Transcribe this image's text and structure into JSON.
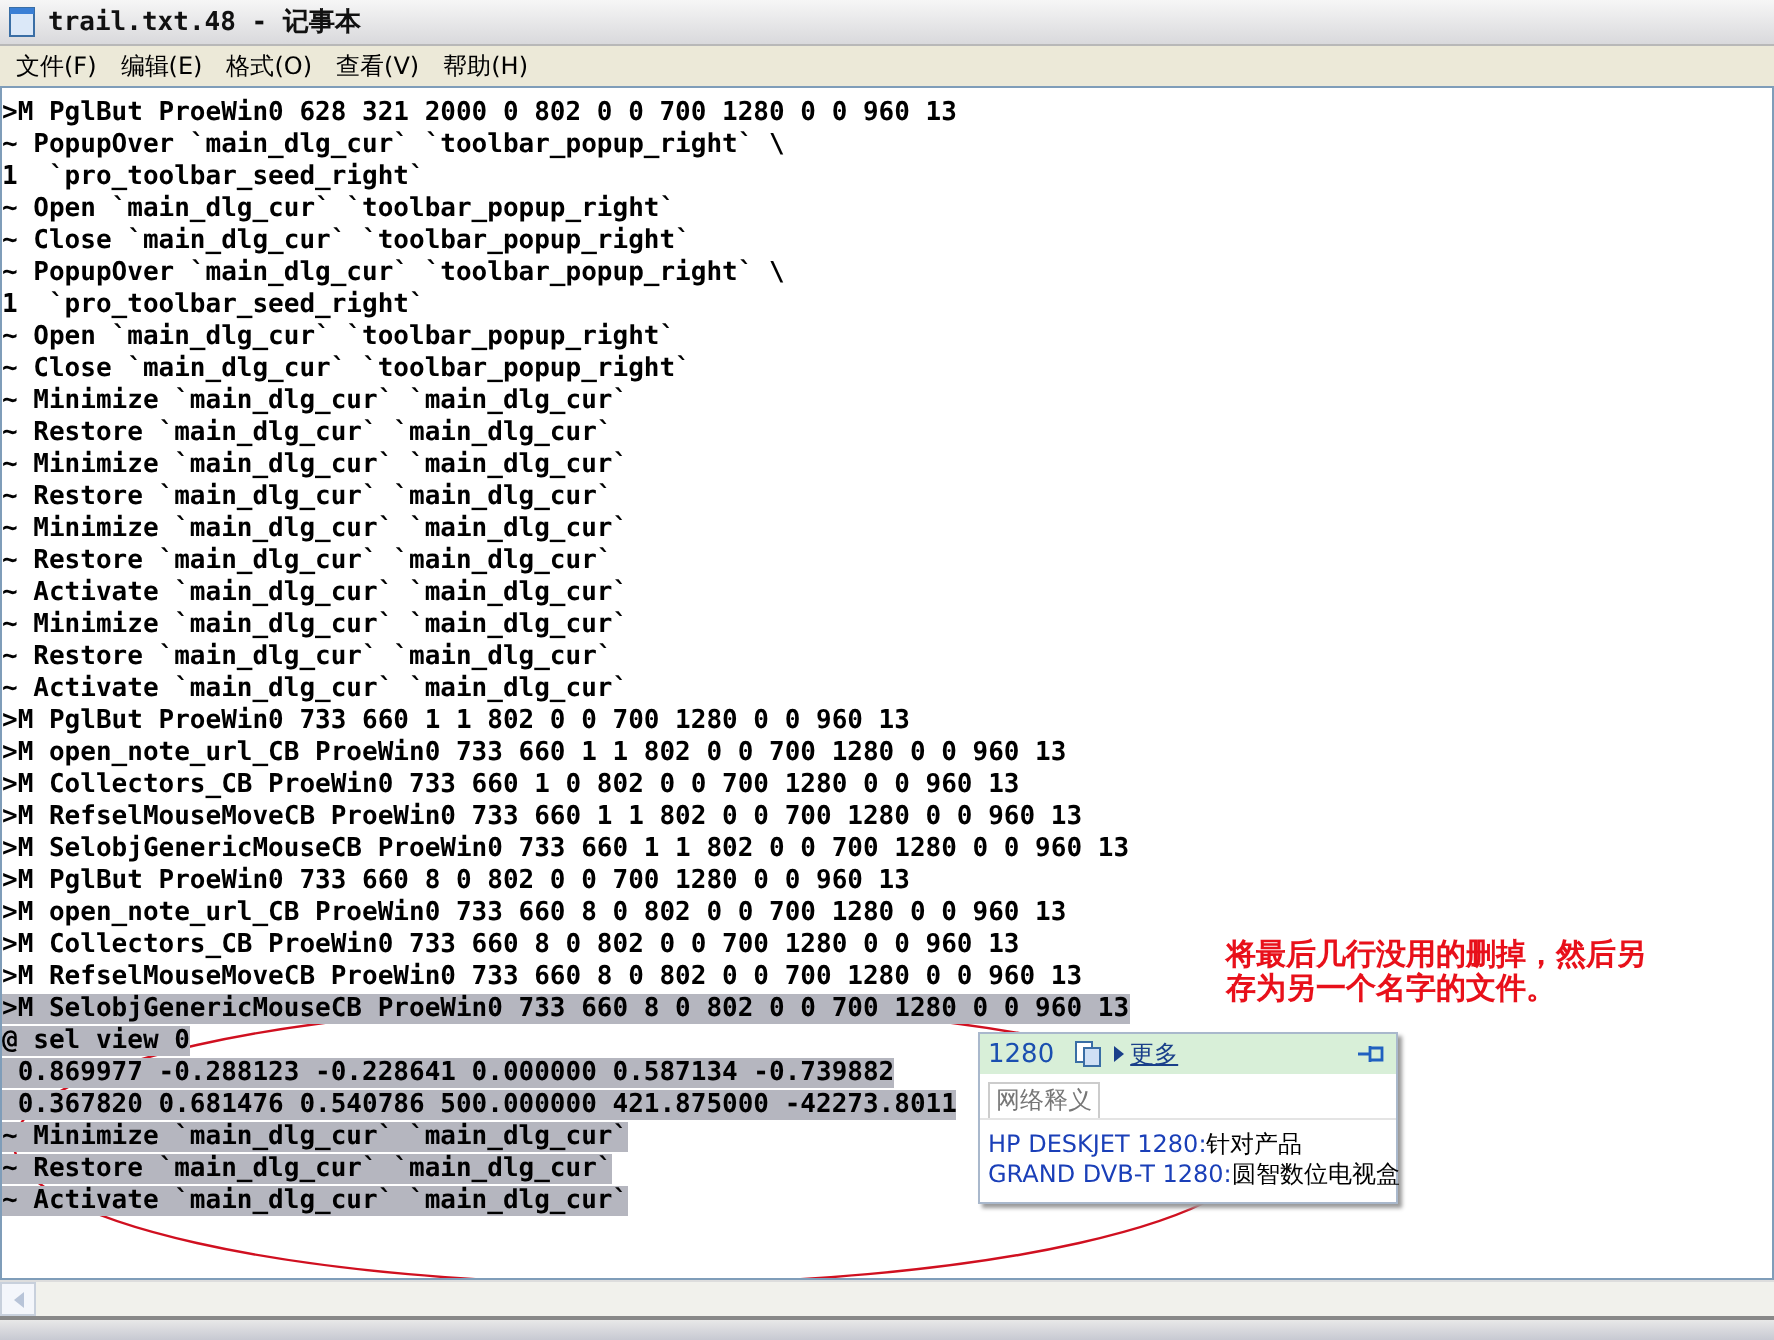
{
  "window": {
    "title": "trail.txt.48 - 记事本"
  },
  "menu": [
    "文件(F)",
    "编辑(E)",
    "格式(O)",
    "查看(V)",
    "帮助(H)"
  ],
  "lines": [
    {
      "text": ">M PglBut ProeWin0 628 321 2000 0 802 0 0 700 1280 0 0 960 13",
      "selected": false
    },
    {
      "text": "~ PopupOver `main_dlg_cur` `toolbar_popup_right` \\",
      "selected": false
    },
    {
      "text": "1  `pro_toolbar_seed_right`",
      "selected": false
    },
    {
      "text": "~ Open `main_dlg_cur` `toolbar_popup_right`",
      "selected": false
    },
    {
      "text": "~ Close `main_dlg_cur` `toolbar_popup_right`",
      "selected": false
    },
    {
      "text": "~ PopupOver `main_dlg_cur` `toolbar_popup_right` \\",
      "selected": false
    },
    {
      "text": "1  `pro_toolbar_seed_right`",
      "selected": false
    },
    {
      "text": "~ Open `main_dlg_cur` `toolbar_popup_right`",
      "selected": false
    },
    {
      "text": "~ Close `main_dlg_cur` `toolbar_popup_right`",
      "selected": false
    },
    {
      "text": "~ Minimize `main_dlg_cur` `main_dlg_cur`",
      "selected": false
    },
    {
      "text": "~ Restore `main_dlg_cur` `main_dlg_cur`",
      "selected": false
    },
    {
      "text": "~ Minimize `main_dlg_cur` `main_dlg_cur`",
      "selected": false
    },
    {
      "text": "~ Restore `main_dlg_cur` `main_dlg_cur`",
      "selected": false
    },
    {
      "text": "~ Minimize `main_dlg_cur` `main_dlg_cur`",
      "selected": false
    },
    {
      "text": "~ Restore `main_dlg_cur` `main_dlg_cur`",
      "selected": false
    },
    {
      "text": "~ Activate `main_dlg_cur` `main_dlg_cur`",
      "selected": false
    },
    {
      "text": "~ Minimize `main_dlg_cur` `main_dlg_cur`",
      "selected": false
    },
    {
      "text": "~ Restore `main_dlg_cur` `main_dlg_cur`",
      "selected": false
    },
    {
      "text": "~ Activate `main_dlg_cur` `main_dlg_cur`",
      "selected": false
    },
    {
      "text": ">M PglBut ProeWin0 733 660 1 1 802 0 0 700 1280 0 0 960 13",
      "selected": false
    },
    {
      "text": ">M open_note_url_CB ProeWin0 733 660 1 1 802 0 0 700 1280 0 0 960 13",
      "selected": false
    },
    {
      "text": ">M Collectors_CB ProeWin0 733 660 1 0 802 0 0 700 1280 0 0 960 13",
      "selected": false
    },
    {
      "text": ">M RefselMouseMoveCB ProeWin0 733 660 1 1 802 0 0 700 1280 0 0 960 13",
      "selected": false
    },
    {
      "text": ">M SelobjGenericMouseCB ProeWin0 733 660 1 1 802 0 0 700 1280 0 0 960 13",
      "selected": false
    },
    {
      "text": ">M PglBut ProeWin0 733 660 8 0 802 0 0 700 1280 0 0 960 13",
      "selected": false
    },
    {
      "text": ">M open_note_url_CB ProeWin0 733 660 8 0 802 0 0 700 1280 0 0 960 13",
      "selected": false
    },
    {
      "text": ">M Collectors_CB ProeWin0 733 660 8 0 802 0 0 700 1280 0 0 960 13",
      "selected": false
    },
    {
      "text": ">M RefselMouseMoveCB ProeWin0 733 660 8 0 802 0 0 700 1280 0 0 960 13",
      "selected": false
    },
    {
      "text": ">M SelobjGenericMouseCB ProeWin0 733 660 8 0 802 0 0 700 1280 0 0 960 13",
      "selected": true
    },
    {
      "text": "@ sel view 0",
      "selected": true
    },
    {
      "text": " 0.869977 -0.288123 -0.228641 0.000000 0.587134 -0.739882",
      "selected": true
    },
    {
      "text": " 0.367820 0.681476 0.540786 500.000000 421.875000 -42273.8011",
      "selected": true
    },
    {
      "text": "~ Minimize `main_dlg_cur` `main_dlg_cur`",
      "selected": true
    },
    {
      "text": "~ Restore `main_dlg_cur` `main_dlg_cur`",
      "selected": true
    },
    {
      "text": "~ Activate `main_dlg_cur` `main_dlg_cur`",
      "selected": true
    }
  ],
  "annotation": {
    "lines": [
      "将最后几行没用的删掉，然后另",
      "存为另一个名字的文件。"
    ]
  },
  "popup": {
    "word": "1280",
    "more_link": "更多",
    "tab": "网络释义",
    "entries": [
      {
        "term": "HP DESKJET 1280:",
        "meaning": "针对产品"
      },
      {
        "term": "GRAND DVB-T 1280:",
        "meaning": "圆智数位电视盒"
      }
    ]
  }
}
